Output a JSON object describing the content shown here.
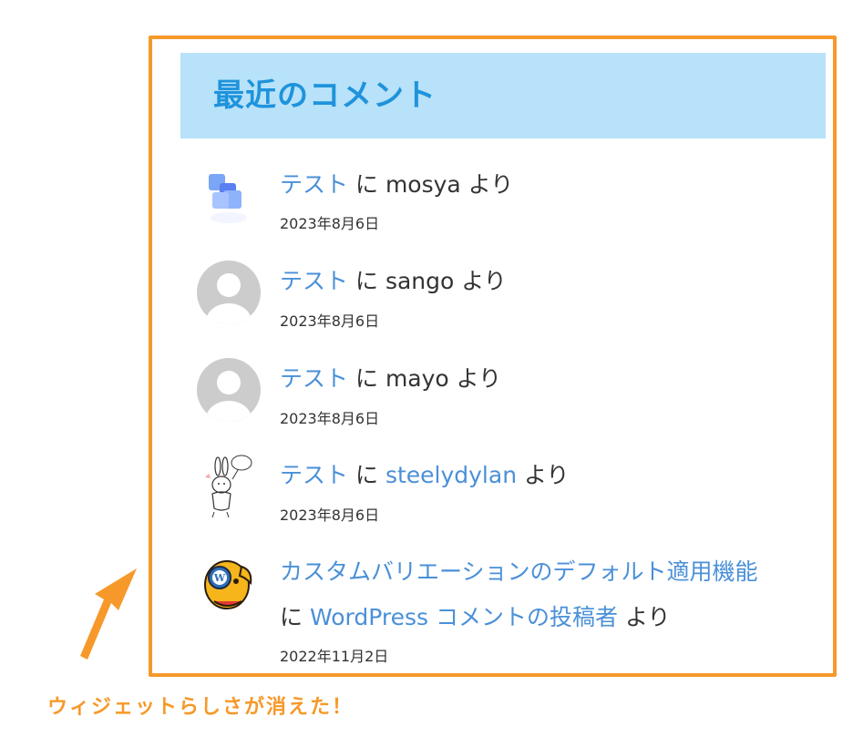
{
  "widget": {
    "title": "最近のコメント",
    "title_color": "#1f93dc",
    "title_bg": "#b8e2f9",
    "frame_color": "#f6992a",
    "link_color": "#4a90d8"
  },
  "comments": [
    {
      "avatar_icon": "blue-logo-avatar-icon",
      "post": "テスト",
      "connector": "に",
      "author": "mosya",
      "author_is_link": false,
      "suffix": "より",
      "date": "2023年8月6日"
    },
    {
      "avatar_icon": "default-user-avatar-icon",
      "post": "テスト",
      "connector": "に",
      "author": "sango",
      "author_is_link": false,
      "suffix": "より",
      "date": "2023年8月6日"
    },
    {
      "avatar_icon": "default-user-avatar-icon",
      "post": "テスト",
      "connector": "に",
      "author": "mayo",
      "author_is_link": false,
      "suffix": "より",
      "date": "2023年8月6日"
    },
    {
      "avatar_icon": "rabbit-drawing-avatar-icon",
      "post": "テスト",
      "connector": "に",
      "author": "steelydylan",
      "author_is_link": true,
      "suffix": "より",
      "date": "2023年8月6日"
    },
    {
      "avatar_icon": "wapuu-avatar-icon",
      "post": "カスタムバリエーションのデフォルト適用機能",
      "connector": "に",
      "author": "WordPress コメントの投稿者",
      "author_is_link": true,
      "suffix": "より",
      "date": "2022年11月2日"
    }
  ],
  "annotation": {
    "text": "ウィジェットらしさが消えた！",
    "color": "#f6992a",
    "arrow_icon": "arrow-up-icon"
  }
}
